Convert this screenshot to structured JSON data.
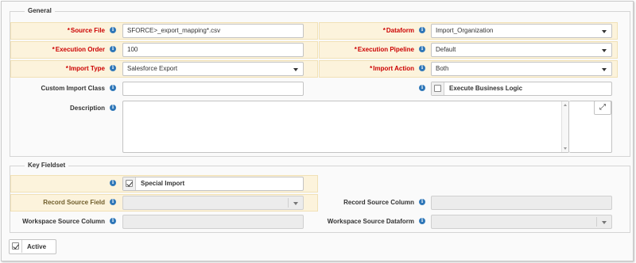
{
  "general": {
    "legend": "General",
    "source_file": {
      "label": "Source File",
      "value": "SFORCE>_export_mapping*.csv"
    },
    "dataform": {
      "label": "Dataform",
      "value": "Import_Organization"
    },
    "execution_order": {
      "label": "Execution Order",
      "value": "100"
    },
    "execution_pipeline": {
      "label": "Execution Pipeline",
      "value": "Default"
    },
    "import_type": {
      "label": "Import Type",
      "value": "Salesforce Export"
    },
    "import_action": {
      "label": "Import Action",
      "value": "Both"
    },
    "custom_import_class": {
      "label": "Custom Import Class",
      "value": ""
    },
    "execute_business_logic": {
      "label": "Execute Business Logic",
      "checked": false
    },
    "description": {
      "label": "Description",
      "value": ""
    }
  },
  "key_fieldset": {
    "legend": "Key Fieldset",
    "special_import": {
      "label": "Special Import",
      "checked": true
    },
    "record_source_field": {
      "label": "Record Source Field",
      "value": ""
    },
    "record_source_column": {
      "label": "Record Source Column",
      "value": ""
    },
    "workspace_source_column": {
      "label": "Workspace Source Column",
      "value": ""
    },
    "workspace_source_dataform": {
      "label": "Workspace Source Dataform",
      "value": ""
    }
  },
  "active": {
    "label": "Active",
    "checked": true
  },
  "required_marker": "*",
  "info_glyph": "i",
  "expand_glyph": "⤢",
  "icons": {
    "info": "info-icon",
    "dropdown": "chevron-down-icon",
    "expand": "expand-icon",
    "check": "check-icon"
  },
  "colors": {
    "required_label": "#cc0000",
    "highlight_bg": "#fcf3dc",
    "info_icon": "#2f77b8"
  }
}
